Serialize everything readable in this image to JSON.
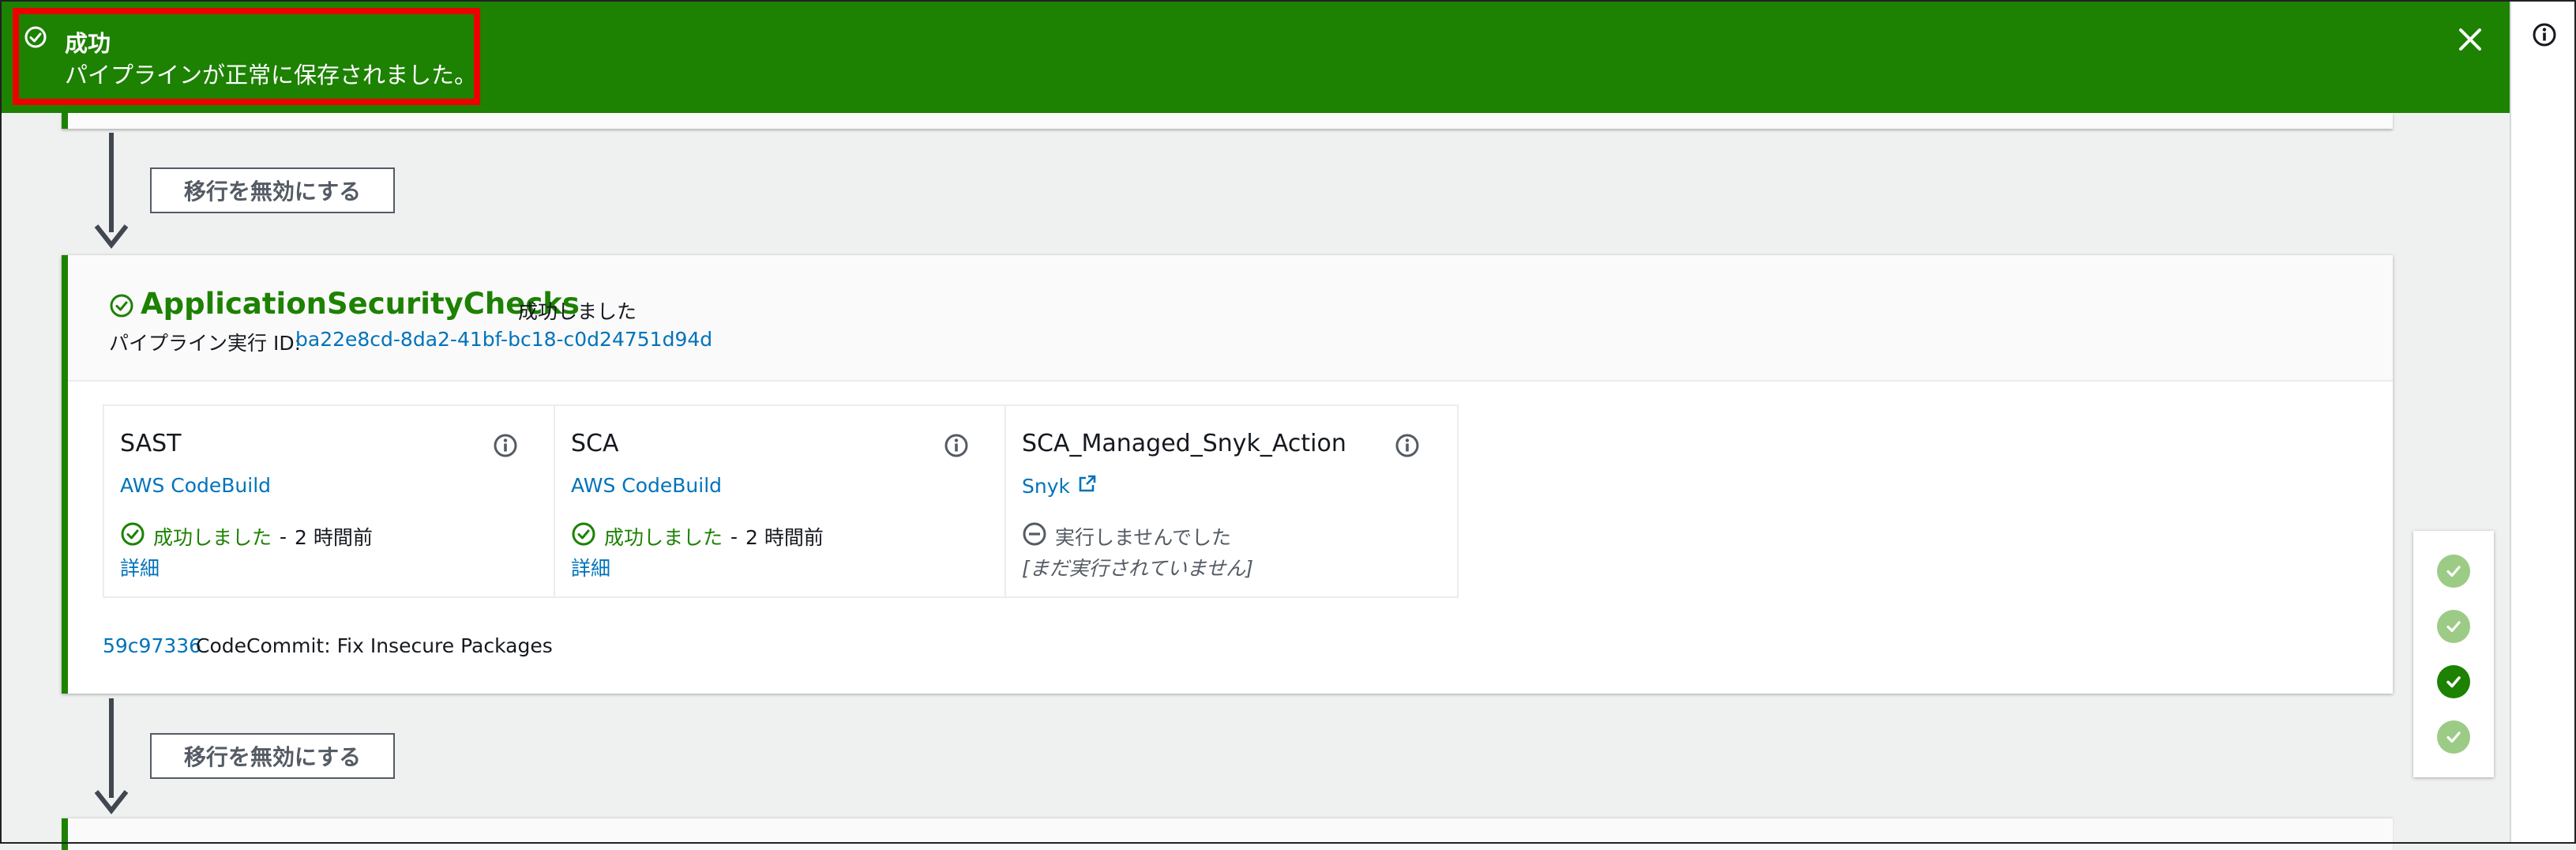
{
  "flash": {
    "title": "成功",
    "message": "パイプラインが正常に保存されました。",
    "type": "success",
    "color": "#1d8102",
    "highlight_color": "#ec0000"
  },
  "transitions": [
    {
      "label": "移行を無効にする"
    },
    {
      "label": "移行を無効にする"
    }
  ],
  "stage": {
    "name": "ApplicationSecurityChecks",
    "status": "成功しました",
    "execution_label": "パイプライン実行 ID:",
    "execution_id": "ba22e8cd-8da2-41bf-bc18-c0d24751d94d",
    "actions": [
      {
        "name": "SAST",
        "provider": "AWS CodeBuild",
        "status": "成功しました",
        "separator": "-",
        "time": "2 時間前",
        "detail": "詳細",
        "state": "succeeded"
      },
      {
        "name": "SCA",
        "provider": "AWS CodeBuild",
        "status": "成功しました",
        "separator": "-",
        "time": "2 時間前",
        "detail": "詳細",
        "state": "succeeded"
      },
      {
        "name": "SCA_Managed_Snyk_Action",
        "provider": "Snyk",
        "provider_icon": "external-link-icon",
        "status": "実行しませんでした",
        "note": "[まだ実行されていません]",
        "state": "didnotrun"
      }
    ],
    "commit_id": "59c97336",
    "commit_message": "CodeCommit: Fix Insecure Packages"
  },
  "navigator": {
    "stages": [
      {
        "state": "succeeded"
      },
      {
        "state": "succeeded"
      },
      {
        "state": "succeeded-current"
      },
      {
        "state": "succeeded"
      }
    ]
  },
  "icons": {
    "flash": "check-circle-icon",
    "close": "close-icon",
    "info": "info-icon",
    "didnotrun": "minus-circle-icon"
  }
}
